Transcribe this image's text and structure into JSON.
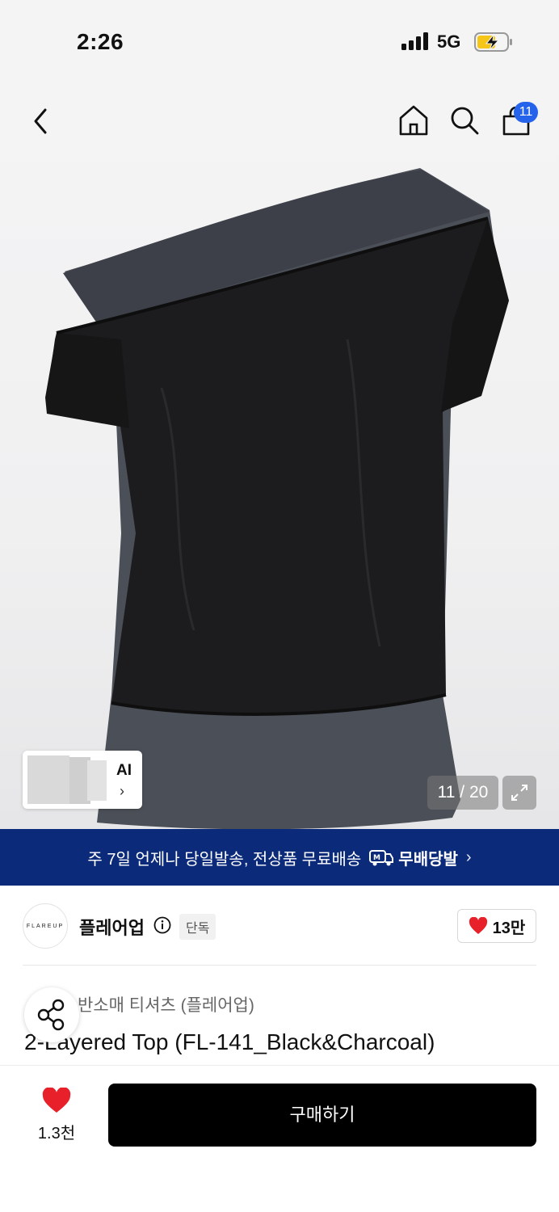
{
  "status_bar": {
    "time": "2:26",
    "network": "5G"
  },
  "header": {
    "cart_count": "11"
  },
  "gallery": {
    "ai_label": "AI",
    "ai_chevron": "›",
    "counter": "11 / 20"
  },
  "banner": {
    "text": "주 7일 언제나 당일발송, 전상품 무료배송",
    "badge": "무배당발",
    "chevron": "›"
  },
  "brand": {
    "logo_text": "FLAREUP",
    "name": "플레어업",
    "tag": "단독",
    "likes": "13만"
  },
  "product": {
    "category": "반소매 티셔츠 (플레어업)",
    "title": "2-Layered Top (FL-141_Black&Charcoal)"
  },
  "bottom_bar": {
    "wish_count": "1.3천",
    "buy_label": "구매하기"
  },
  "colors": {
    "banner_bg": "#0b2a7a",
    "badge_blue": "#2563eb",
    "heart_red": "#e8202a",
    "buy_bg": "#000000"
  }
}
